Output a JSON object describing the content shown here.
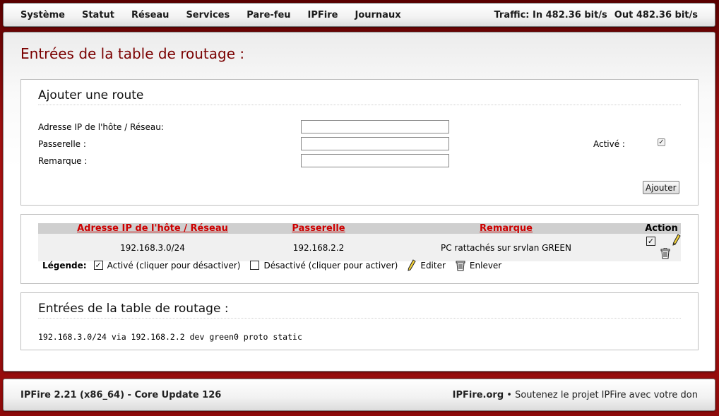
{
  "nav": {
    "items": [
      "Système",
      "Statut",
      "Réseau",
      "Services",
      "Pare-feu",
      "IPFire",
      "Journaux"
    ],
    "traffic_in": "Traffic: In 482.36 bit/s",
    "traffic_out": "Out 482.36 bit/s"
  },
  "page": {
    "title": "Entrées de la table de routage :"
  },
  "add_route": {
    "title": "Ajouter une route",
    "host_label": "Adresse IP de l'hôte / Réseau:",
    "host_value": "",
    "gateway_label": "Passerelle :",
    "gateway_value": "",
    "remark_label": "Remarque :",
    "remark_value": "",
    "active_label": "Activé :",
    "active_checked": true,
    "add_button": "Ajouter"
  },
  "routes_table": {
    "headers": {
      "host": "Adresse IP de l'hôte / Réseau",
      "gateway": "Passerelle",
      "remark": "Remarque",
      "action": "Action"
    },
    "rows": [
      {
        "host": "192.168.3.0/24",
        "gateway": "192.168.2.2",
        "remark": "PC rattachés sur srvlan GREEN",
        "enabled": true
      }
    ],
    "legend": {
      "title": "Légende:",
      "enabled": "Activé (cliquer pour désactiver)",
      "disabled": "Désactivé (cliquer pour activer)",
      "edit": "Editer",
      "remove": "Enlever"
    }
  },
  "routing_entries": {
    "title": "Entrées de la table de routage :",
    "lines": [
      "192.168.3.0/24 via 192.168.2.2 dev green0 proto static"
    ]
  },
  "footer": {
    "version": "IPFire 2.21 (x86_64) - Core Update 126",
    "site": "IPFire.org",
    "separator": "•",
    "support": "Soutenez le projet IPFire avec votre don"
  },
  "colors": {
    "background_red": "#b81414",
    "title_red": "#7a0000",
    "link_red": "#cc0000"
  }
}
